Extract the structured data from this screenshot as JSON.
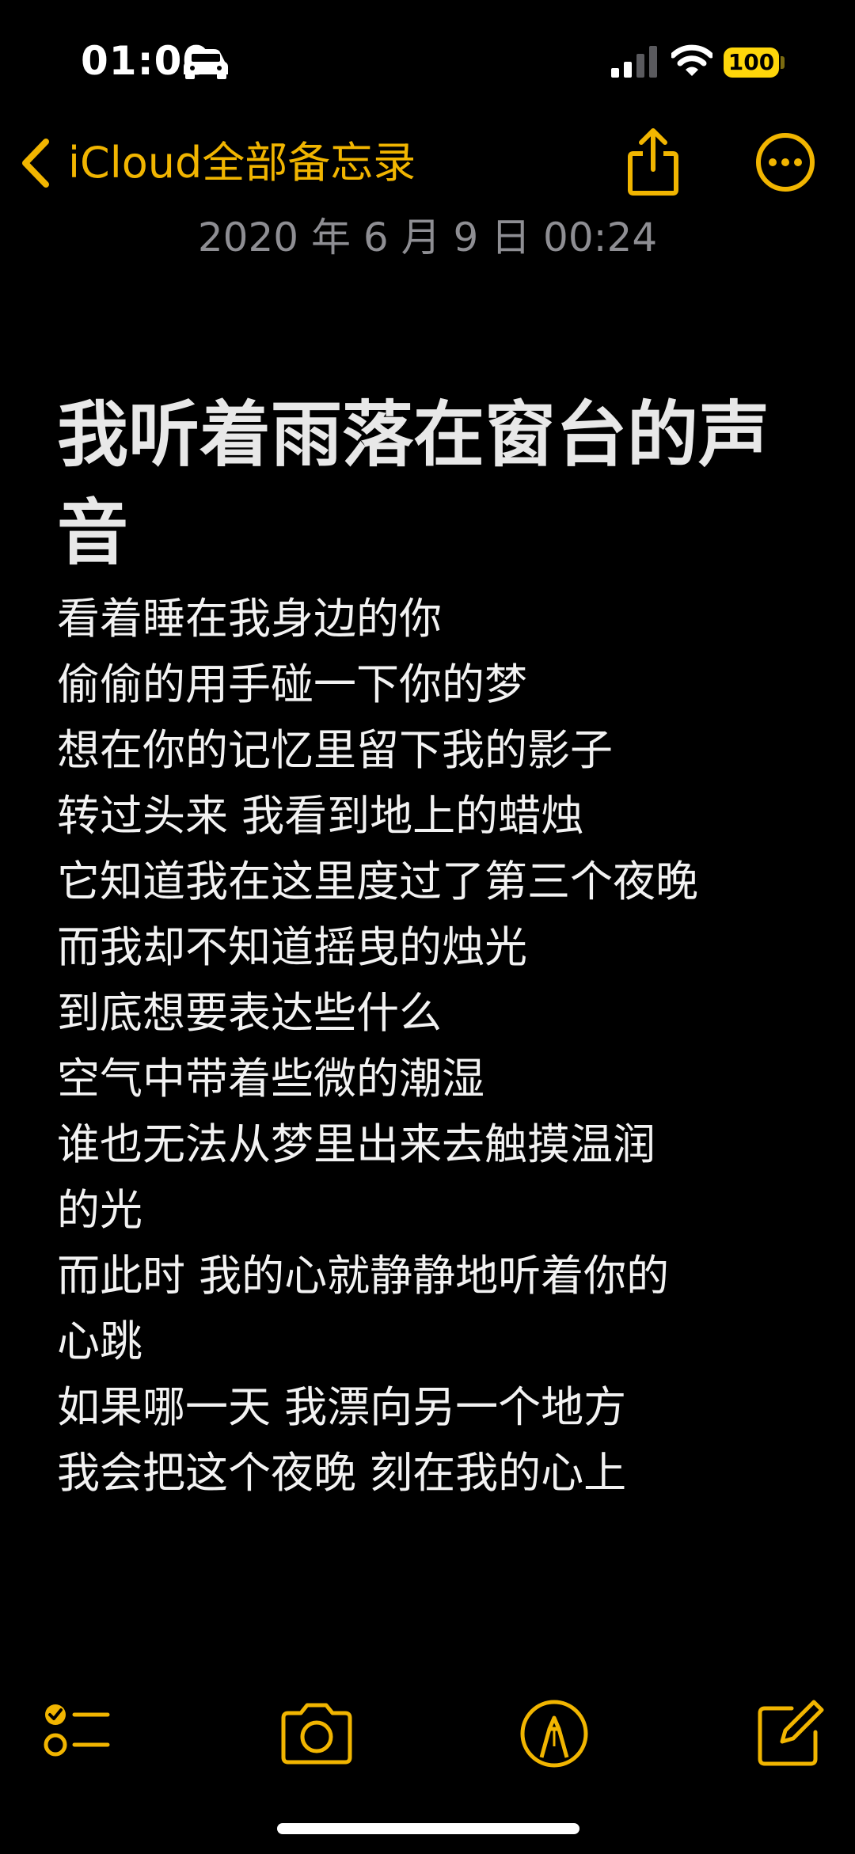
{
  "status_bar": {
    "time": "01:00",
    "battery": "100",
    "icons": [
      "car-icon",
      "signal-icon",
      "wifi-icon",
      "battery-icon"
    ]
  },
  "nav": {
    "back_label": "iCloud全部备忘录",
    "back_icon": "chevron-left-icon",
    "share_icon": "share-icon",
    "more_icon": "ellipsis-circle-icon"
  },
  "note": {
    "date": "2020 年 6 月 9 日 00:24",
    "title": "我听着雨落在窗台的声音",
    "lines": [
      "看着睡在我身边的你",
      "偷偷的用手碰一下你的梦",
      "想在你的记忆里留下我的影子",
      "转过头来 我看到地上的蜡烛",
      "它知道我在这里度过了第三个夜晚",
      "而我却不知道摇曳的烛光",
      "到底想要表达些什么",
      "空气中带着些微的潮湿",
      "谁也无法从梦里出来去触摸温润",
      "的光",
      "而此时 我的心就静静地听着你的",
      "心跳",
      "如果哪一天 我漂向另一个地方",
      "我会把这个夜晚 刻在我的心上"
    ]
  },
  "toolbar": {
    "icons": [
      "checklist-icon",
      "camera-icon",
      "markup-icon",
      "compose-icon"
    ]
  },
  "colors": {
    "accent": "#f1b500",
    "background": "#000000",
    "date_text": "#8e8e93",
    "battery": "#fed60a"
  }
}
